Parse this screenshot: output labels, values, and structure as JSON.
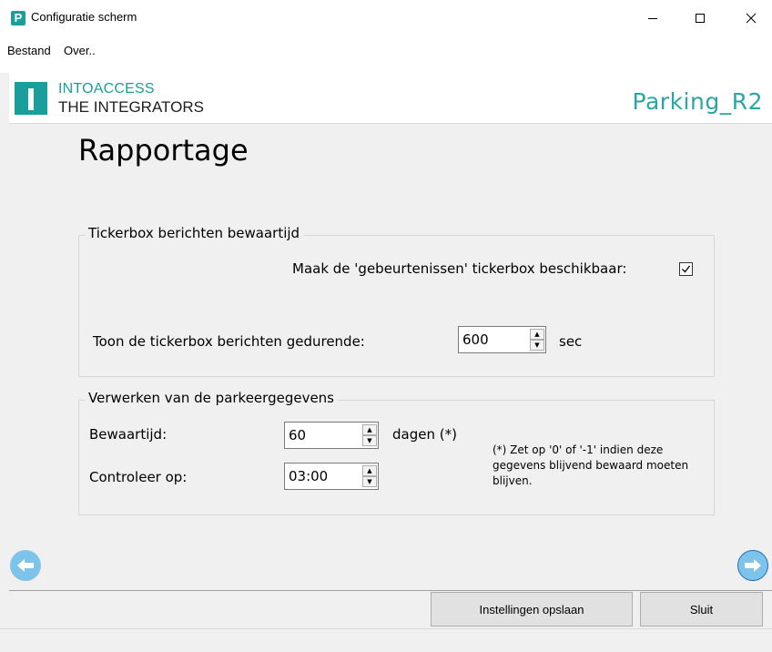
{
  "window": {
    "app_icon_letter": "P",
    "title": "Configuratie scherm"
  },
  "menu": {
    "items": [
      {
        "label": "Bestand"
      },
      {
        "label": "Over.."
      }
    ]
  },
  "header": {
    "logo_line1": "INTOACCESS",
    "logo_line2": "THE INTEGRATORS",
    "machine_name": "Parking_R2",
    "accent_color": "#1a9e9b"
  },
  "main": {
    "page_title": "Rapportage",
    "tickerbox_group": {
      "legend": "Tickerbox berichten bewaartijd",
      "enable_label": "Maak de 'gebeurtenissen' tickerbox beschikbaar:",
      "enable_checked": true,
      "duration_label": "Toon de tickerbox berichten gedurende:",
      "duration_value": "600",
      "duration_unit": "sec"
    },
    "parking_group": {
      "legend": "Verwerken van de parkeergegevens",
      "retention_label": "Bewaartijd:",
      "retention_value": "60",
      "retention_unit": "dagen (*)",
      "check_label": "Controleer op:",
      "check_value": "03:00",
      "note": "(*) Zet op '0' of '-1' indien deze gegevens blijvend bewaard moeten blijven."
    }
  },
  "footer": {
    "save_label": "Instellingen opslaan",
    "close_label": "Sluit"
  },
  "icons": {
    "nav_back": "arrow-left-circle-icon",
    "nav_forward": "arrow-right-circle-icon",
    "nav_color": "#7ec3e9"
  }
}
